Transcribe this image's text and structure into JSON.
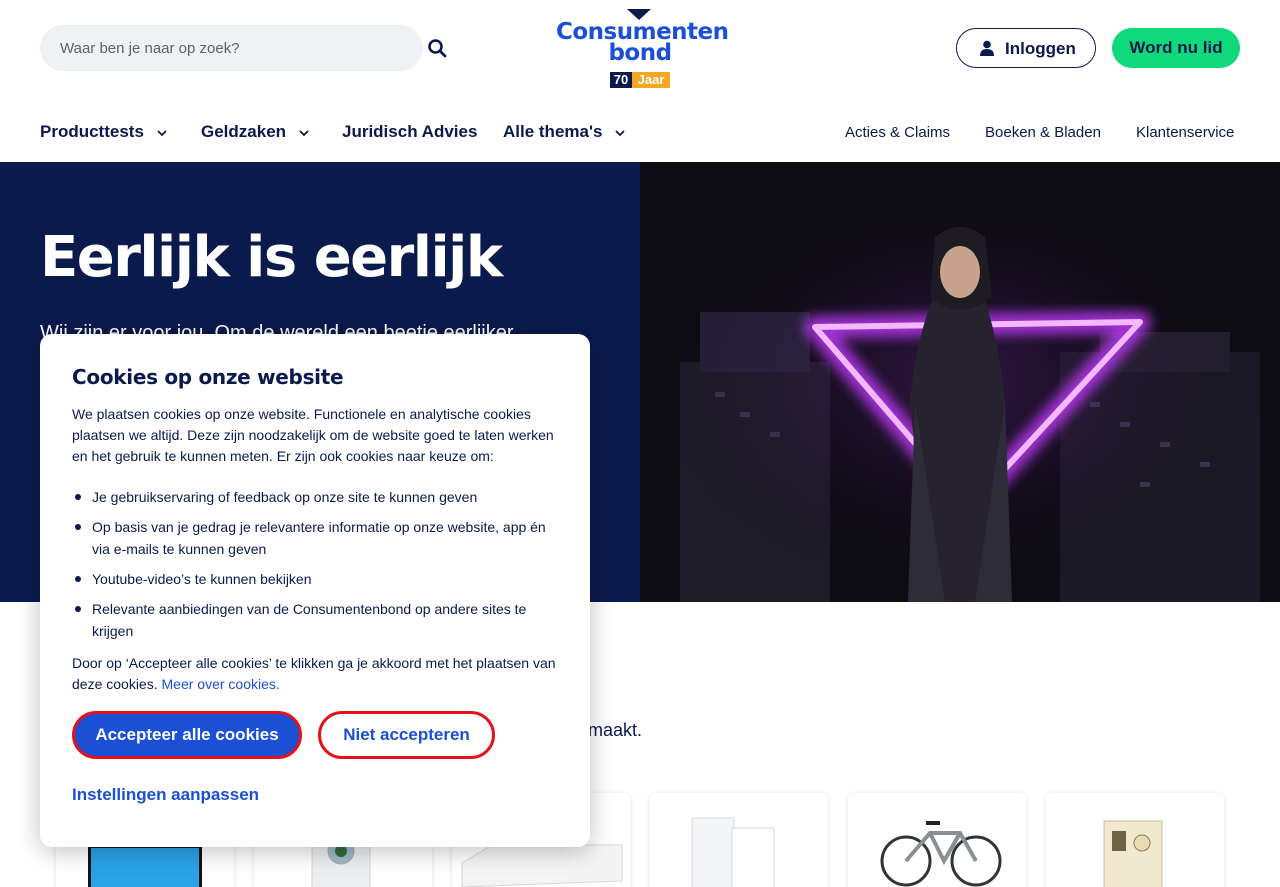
{
  "search": {
    "placeholder": "Waar ben je naar op zoek?"
  },
  "logo": {
    "line1": "Consumenten",
    "line2": "bond",
    "badge_num": "70",
    "badge_word": "Jaar"
  },
  "header": {
    "login_label": "Inloggen",
    "join_label": "Word nu lid"
  },
  "nav": {
    "main": [
      {
        "label": "Producttests"
      },
      {
        "label": "Geldzaken"
      },
      {
        "label": "Juridisch Advies"
      },
      {
        "label": "Alle thema's"
      }
    ],
    "secondary": [
      {
        "label": "Acties & Claims"
      },
      {
        "label": "Boeken & Bladen"
      },
      {
        "label": "Klantenservice"
      }
    ]
  },
  "hero": {
    "title": "Eerlijk is eerlijk",
    "subtitle": "Wij zijn er voor jou. Om de wereld een beetje eerlijker"
  },
  "below": {
    "partial_text": "maakt."
  },
  "cookie": {
    "title": "Cookies op onze website",
    "intro": "We plaatsen cookies op onze website. Functionele en analytische cookies plaatsen we altijd. Deze zijn noodzakelijk om de website goed te laten werken en het gebruik te kunnen meten. Er zijn ook cookies naar keuze om:",
    "items": [
      "Je gebruikservaring of feedback op onze site te kunnen geven",
      "Op basis van je gedrag je relevantere informatie op onze website, app én via e-mails te kunnen geven",
      "Youtube-video’s te kunnen bekijken",
      "Relevante aanbiedingen van de Consumentenbond op andere sites te krijgen"
    ],
    "footer": "Door op ‘Accepteer alle cookies’ te klikken ga je akkoord met het plaatsen van deze cookies.",
    "more_link": "Meer over cookies.",
    "accept_label": "Accepteer alle cookies",
    "reject_label": "Niet accepteren",
    "settings_label": "Instellingen aanpassen"
  },
  "colors": {
    "navy": "#0b1a4d",
    "brand_blue": "#1a4fd6",
    "green": "#10d97c",
    "focus_red": "#e5121a",
    "badge_orange": "#f5a623"
  },
  "icons": {
    "search": "search-icon",
    "user": "user-icon",
    "chevron": "chevron-down-icon"
  }
}
